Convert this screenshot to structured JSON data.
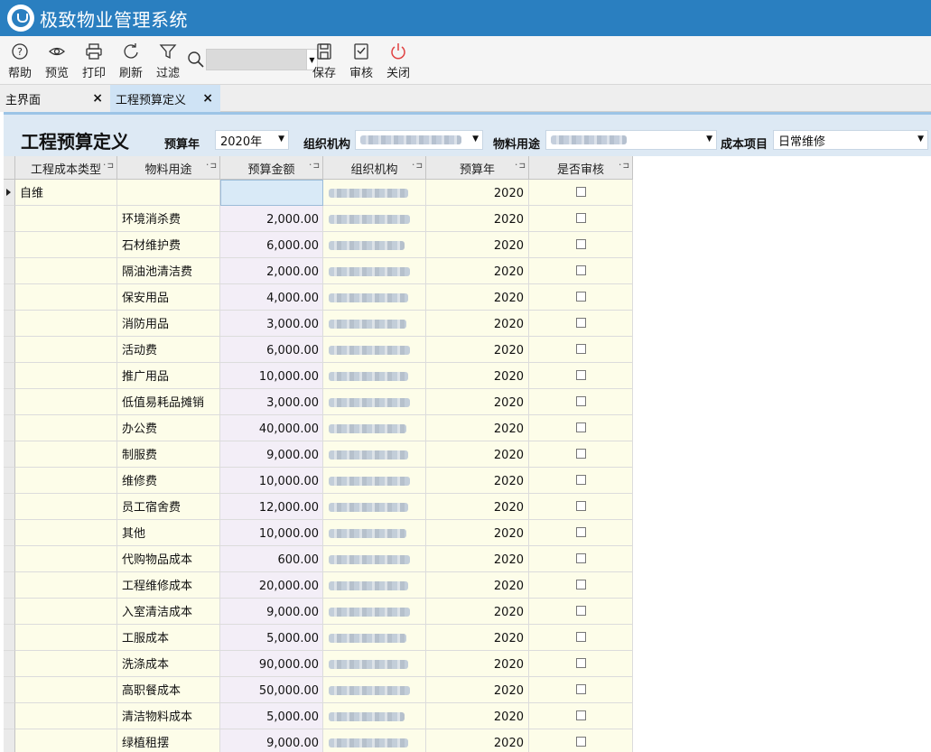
{
  "app": {
    "title": "极致物业管理系统"
  },
  "toolbar": {
    "help": "帮助",
    "preview": "预览",
    "print": "打印",
    "refresh": "刷新",
    "filter": "过滤",
    "search_value": "",
    "save": "保存",
    "audit": "审核",
    "close": "关闭",
    "close_color": "#e04040"
  },
  "tabs": [
    {
      "label": "主界面",
      "close": "×"
    },
    {
      "label": "工程预算定义",
      "close": "×",
      "active": true
    }
  ],
  "filter": {
    "page_title": "工程预算定义",
    "year_label": "预算年",
    "year_value": "2020年",
    "org_label": "组织机构",
    "use_label": "物料用途",
    "cost_label": "成本项目",
    "cost_value": "日常维修"
  },
  "grid": {
    "columns": [
      "工程成本类型",
      "物料用途",
      "预算金额",
      "组织机构",
      "预算年",
      "是否审核"
    ],
    "rows": [
      {
        "type": "自维",
        "use": "",
        "amount": "",
        "year": "2020"
      },
      {
        "type": "",
        "use": "环境消杀费",
        "amount": "2,000.00",
        "year": "2020"
      },
      {
        "type": "",
        "use": "石材维护费",
        "amount": "6,000.00",
        "year": "2020"
      },
      {
        "type": "",
        "use": "隔油池清洁费",
        "amount": "2,000.00",
        "year": "2020"
      },
      {
        "type": "",
        "use": "保安用品",
        "amount": "4,000.00",
        "year": "2020"
      },
      {
        "type": "",
        "use": "消防用品",
        "amount": "3,000.00",
        "year": "2020"
      },
      {
        "type": "",
        "use": "活动费",
        "amount": "6,000.00",
        "year": "2020"
      },
      {
        "type": "",
        "use": "推广用品",
        "amount": "10,000.00",
        "year": "2020"
      },
      {
        "type": "",
        "use": "低值易耗品摊销",
        "amount": "3,000.00",
        "year": "2020"
      },
      {
        "type": "",
        "use": "办公费",
        "amount": "40,000.00",
        "year": "2020"
      },
      {
        "type": "",
        "use": "制服费",
        "amount": "9,000.00",
        "year": "2020"
      },
      {
        "type": "",
        "use": "维修费",
        "amount": "10,000.00",
        "year": "2020"
      },
      {
        "type": "",
        "use": "员工宿舍费",
        "amount": "12,000.00",
        "year": "2020"
      },
      {
        "type": "",
        "use": "其他",
        "amount": "10,000.00",
        "year": "2020"
      },
      {
        "type": "",
        "use": "代购物品成本",
        "amount": "600.00",
        "year": "2020"
      },
      {
        "type": "",
        "use": "工程维修成本",
        "amount": "20,000.00",
        "year": "2020"
      },
      {
        "type": "",
        "use": "入室清洁成本",
        "amount": "9,000.00",
        "year": "2020"
      },
      {
        "type": "",
        "use": "工服成本",
        "amount": "5,000.00",
        "year": "2020"
      },
      {
        "type": "",
        "use": "洗涤成本",
        "amount": "90,000.00",
        "year": "2020"
      },
      {
        "type": "",
        "use": "高职餐成本",
        "amount": "50,000.00",
        "year": "2020"
      },
      {
        "type": "",
        "use": "清洁物料成本",
        "amount": "5,000.00",
        "year": "2020"
      },
      {
        "type": "",
        "use": "绿植租摆",
        "amount": "9,000.00",
        "year": "2020"
      }
    ]
  }
}
